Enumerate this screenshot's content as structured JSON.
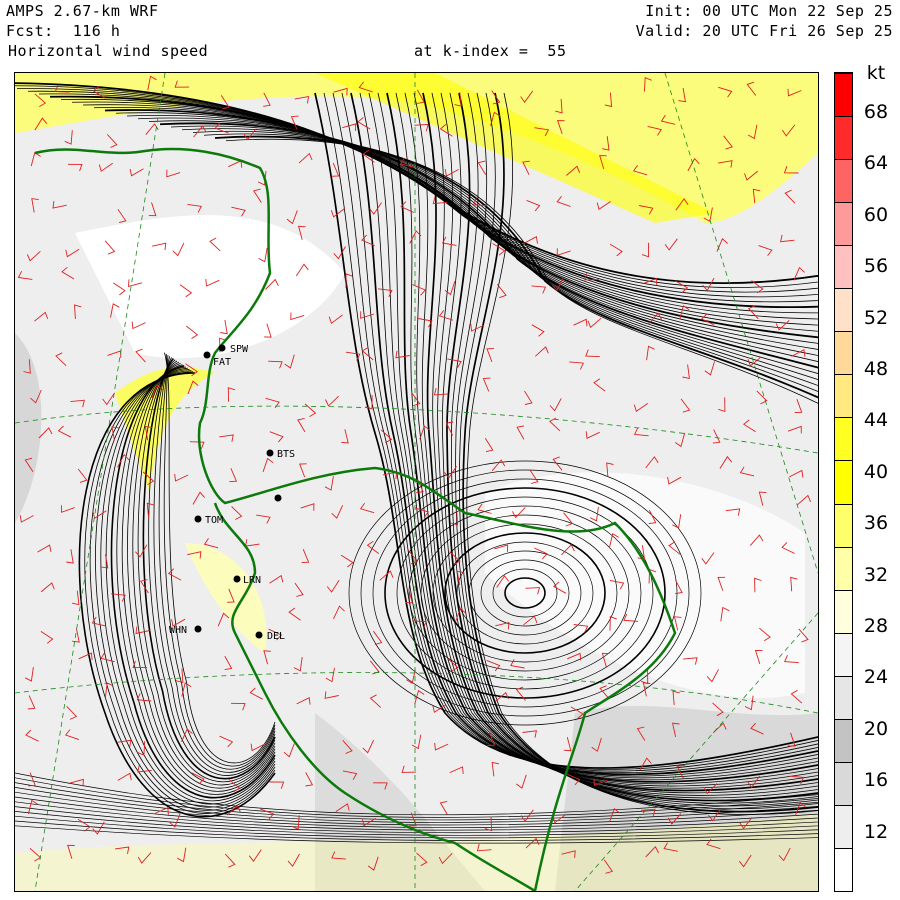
{
  "header": {
    "model": "AMPS 2.67-km WRF",
    "forecast": "Fcst:  116 h",
    "field": "Horizontal wind speed",
    "level": "at k-index =  55",
    "init": "Init: 00 UTC Mon 22 Sep 25",
    "valid": "Valid: 20 UTC Fri 26 Sep 25"
  },
  "colorbar": {
    "unit": "kt",
    "ticks": [
      "68",
      "64",
      "60",
      "56",
      "52",
      "48",
      "44",
      "40",
      "36",
      "32",
      "28",
      "24",
      "20",
      "16",
      "12"
    ],
    "colors": [
      "#ffffff",
      "#eeeeee",
      "#d9d9d9",
      "#c3c3c3",
      "#e6e6e6",
      "#f5f5f5",
      "#ffffdd",
      "#ffffa8",
      "#ffff6a",
      "#ffff00",
      "#ffff22",
      "#ffe980",
      "#ffd89a",
      "#ffe0c8",
      "#ffc0c0",
      "#ff9a9a",
      "#ff6464",
      "#ff2a2a",
      "#ff0000"
    ]
  },
  "stations": [
    {
      "id": "SPW",
      "label": "SPW"
    },
    {
      "id": "FAT",
      "label": "FAT"
    },
    {
      "id": "BTS",
      "label": "BTS"
    },
    {
      "id": "TOM",
      "label": "TOM"
    },
    {
      "id": "LRN",
      "label": "LRN"
    },
    {
      "id": "WHN",
      "label": "WHN"
    },
    {
      "id": "DEL",
      "label": "DEL"
    },
    {
      "id": "OPN",
      "label": ""
    }
  ]
}
